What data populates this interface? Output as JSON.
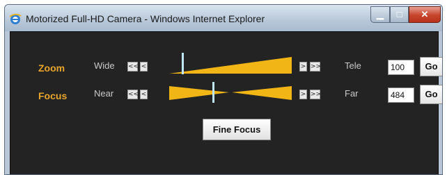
{
  "window": {
    "title": "Motorized Full-HD Camera - Windows Internet Explorer",
    "controls": {
      "minimize": "▁",
      "maximize": "□",
      "close": "✕"
    }
  },
  "zoom": {
    "label": "Zoom",
    "min_label": "Wide",
    "max_label": "Tele",
    "fast_back": "<<",
    "back": "<",
    "forward": ">",
    "fast_forward": ">>",
    "value": "100",
    "go_label": "Go",
    "slider_level": 0.1
  },
  "focus": {
    "label": "Focus",
    "min_label": "Near",
    "max_label": "Far",
    "fast_back": "<<",
    "back": "<",
    "forward": ">",
    "fast_forward": ">>",
    "value": "484",
    "go_label": "Go",
    "slider_level": 0.35
  },
  "fine_focus": {
    "label": "Fine Focus"
  },
  "colors": {
    "accent": "#e9a52a",
    "slider_fill": "#f2b516",
    "indicator": "#bfe6f2",
    "background": "#232323"
  },
  "icons": {
    "app": "ie-icon"
  }
}
